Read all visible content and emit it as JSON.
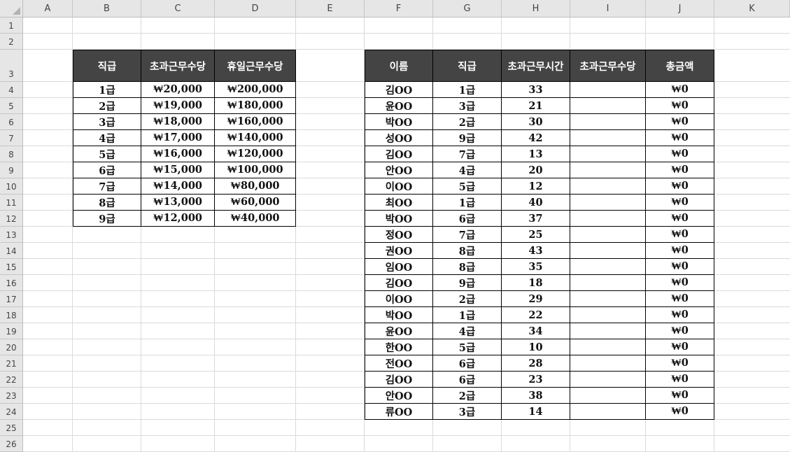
{
  "columns": [
    "A",
    "B",
    "C",
    "D",
    "E",
    "F",
    "G",
    "H",
    "I",
    "J",
    "K"
  ],
  "rows": [
    "1",
    "2",
    "3",
    "4",
    "5",
    "6",
    "7",
    "8",
    "9",
    "10",
    "11",
    "12",
    "13",
    "14",
    "15",
    "16",
    "17",
    "18",
    "19",
    "20",
    "21",
    "22",
    "23",
    "24",
    "25",
    "26"
  ],
  "table1": {
    "headers": [
      "직급",
      "초과근무수당",
      "휴일근무수당"
    ],
    "rows": [
      [
        "1급",
        "₩20,000",
        "₩200,000"
      ],
      [
        "2급",
        "₩19,000",
        "₩180,000"
      ],
      [
        "3급",
        "₩18,000",
        "₩160,000"
      ],
      [
        "4급",
        "₩17,000",
        "₩140,000"
      ],
      [
        "5급",
        "₩16,000",
        "₩120,000"
      ],
      [
        "6급",
        "₩15,000",
        "₩100,000"
      ],
      [
        "7급",
        "₩14,000",
        "₩80,000"
      ],
      [
        "8급",
        "₩13,000",
        "₩60,000"
      ],
      [
        "9급",
        "₩12,000",
        "₩40,000"
      ]
    ]
  },
  "table2": {
    "headers": [
      "이름",
      "직급",
      "초과근무시간",
      "초과근무수당",
      "총금액"
    ],
    "rows": [
      [
        "김OO",
        "1급",
        "33",
        "",
        "₩0"
      ],
      [
        "윤OO",
        "3급",
        "21",
        "",
        "₩0"
      ],
      [
        "박OO",
        "2급",
        "30",
        "",
        "₩0"
      ],
      [
        "성OO",
        "9급",
        "42",
        "",
        "₩0"
      ],
      [
        "김OO",
        "7급",
        "13",
        "",
        "₩0"
      ],
      [
        "안OO",
        "4급",
        "20",
        "",
        "₩0"
      ],
      [
        "이OO",
        "5급",
        "12",
        "",
        "₩0"
      ],
      [
        "최OO",
        "1급",
        "40",
        "",
        "₩0"
      ],
      [
        "박OO",
        "6급",
        "37",
        "",
        "₩0"
      ],
      [
        "정OO",
        "7급",
        "25",
        "",
        "₩0"
      ],
      [
        "권OO",
        "8급",
        "43",
        "",
        "₩0"
      ],
      [
        "임OO",
        "8급",
        "35",
        "",
        "₩0"
      ],
      [
        "김OO",
        "9급",
        "18",
        "",
        "₩0"
      ],
      [
        "이OO",
        "2급",
        "29",
        "",
        "₩0"
      ],
      [
        "박OO",
        "1급",
        "22",
        "",
        "₩0"
      ],
      [
        "윤OO",
        "4급",
        "34",
        "",
        "₩0"
      ],
      [
        "한OO",
        "5급",
        "10",
        "",
        "₩0"
      ],
      [
        "전OO",
        "6급",
        "28",
        "",
        "₩0"
      ],
      [
        "김OO",
        "6급",
        "23",
        "",
        "₩0"
      ],
      [
        "안OO",
        "2급",
        "38",
        "",
        "₩0"
      ],
      [
        "류OO",
        "3급",
        "14",
        "",
        "₩0"
      ]
    ]
  },
  "colors": {
    "header_bg": "#444444",
    "header_text": "#ffffff",
    "gridline": "#dadada",
    "sheet_header_bg": "#e6e6e6"
  }
}
